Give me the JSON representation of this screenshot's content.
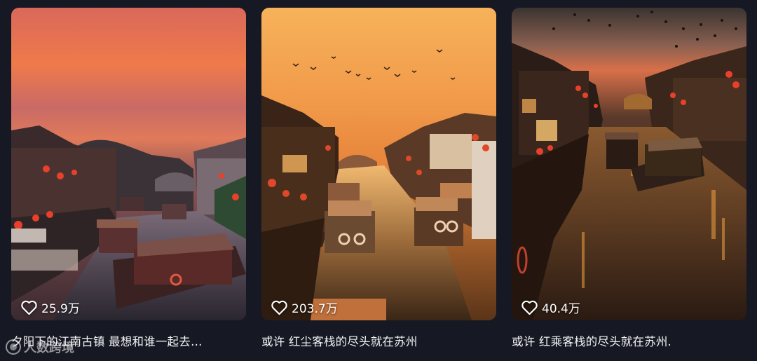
{
  "feed": {
    "cards": [
      {
        "likes": "25.9万",
        "caption": "夕阳下的江南古镇 最想和谁一起去…"
      },
      {
        "likes": "203.7万",
        "caption": "或许 红尘客栈的尽头就在苏州"
      },
      {
        "likes": "40.4万",
        "caption": "或许 红乘客栈的尽头就在苏州."
      }
    ]
  },
  "watermark": {
    "text": "人数跨境"
  },
  "colors": {
    "background": "#161823",
    "caption_text": "#f2f2f4",
    "like_icon": "#ffffff"
  },
  "icons": {
    "like": "heart-outline-icon"
  }
}
